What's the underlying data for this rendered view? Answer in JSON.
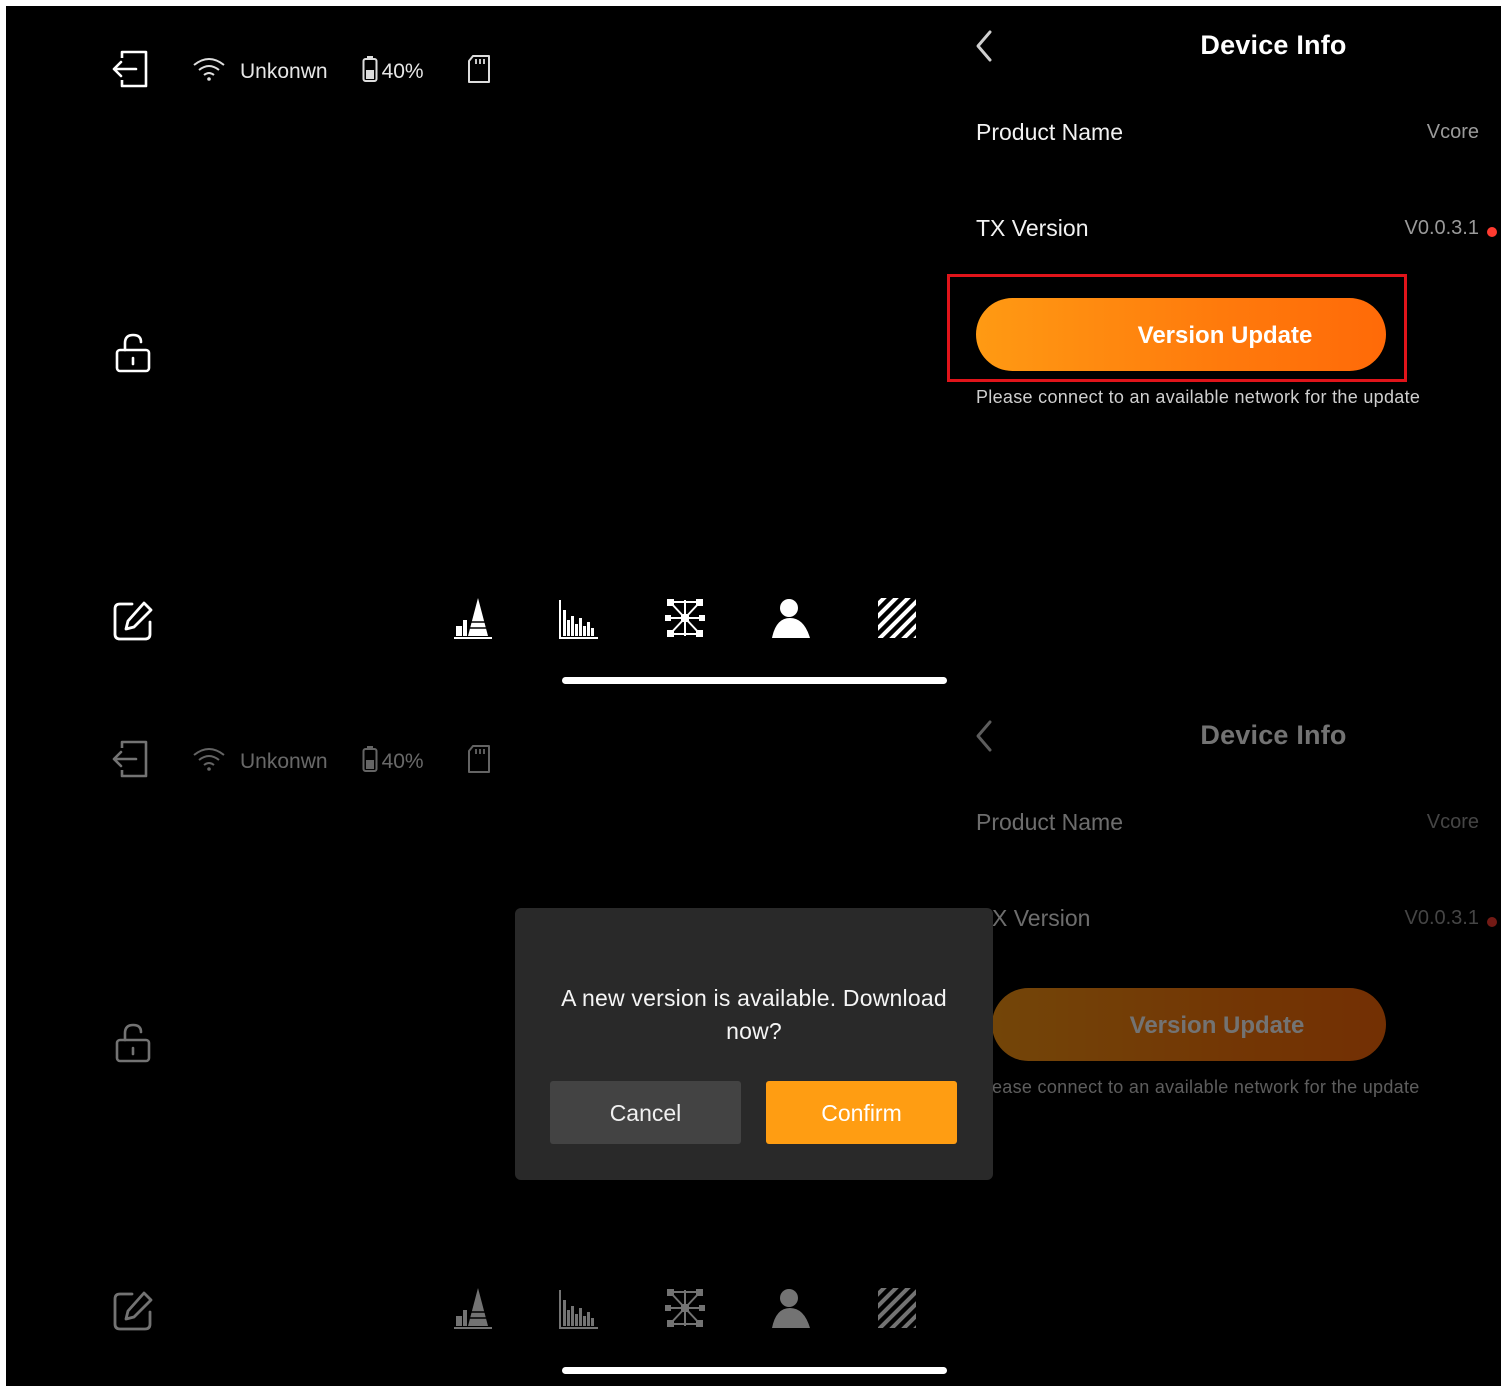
{
  "screen_before": {
    "status": {
      "network": "Unkonwn",
      "battery": "40%"
    },
    "panel": {
      "title": "Device Info",
      "product_name_label": "Product Name",
      "product_name_value": "Vcore",
      "tx_version_label": "TX Version",
      "tx_version_value": "V0.0.3.1",
      "update_button": "Version Update",
      "hint": "Please connect to an available network for the update"
    },
    "mode_icons": [
      "waveform-peak-icon",
      "histogram-icon",
      "network-icon",
      "portrait-icon",
      "zebra-stripes-icon"
    ]
  },
  "screen_after": {
    "status": {
      "network": "Unkonwn",
      "battery": "40%"
    },
    "panel": {
      "title": "Device Info",
      "product_name_label": "Product Name",
      "product_name_value": "Vcore",
      "tx_version_label": "X Version",
      "tx_version_value": "V0.0.3.1",
      "update_button": "Version Update",
      "hint": "ease connect to an available network for the update"
    },
    "dialog": {
      "message": "A new version is available. Download now?",
      "cancel": "Cancel",
      "confirm": "Confirm"
    }
  },
  "colors": {
    "accent_orange": "#ff9d12",
    "highlight_red": "#e0141a",
    "notification_dot": "#ff3b30"
  }
}
